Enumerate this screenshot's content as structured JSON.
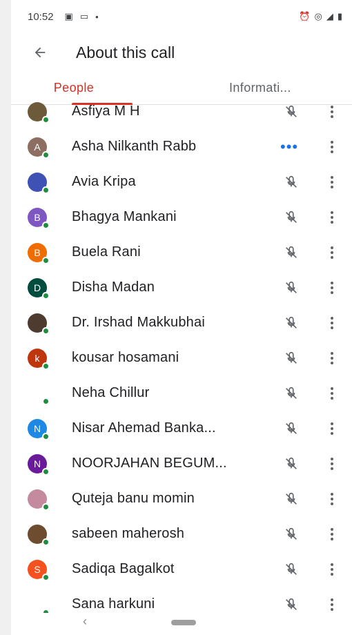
{
  "status_bar": {
    "time": "10:52",
    "left_icons": [
      "gallery-icon",
      "video-icon",
      "dot-icon"
    ],
    "right_icons": [
      "alarm-icon",
      "hotspot-icon",
      "signal-icon",
      "battery-icon"
    ]
  },
  "app_bar": {
    "back_icon": "arrow-left-icon",
    "title": "About this call"
  },
  "tabs": [
    {
      "label": "People",
      "active": true
    },
    {
      "label": "Informati...",
      "active": false
    }
  ],
  "participants": [
    {
      "name": "Asfiya M H",
      "avatar_letter": "",
      "avatar_color": "#6d5a3b",
      "status": "muted"
    },
    {
      "name": "Asha Nilkanth Rabb",
      "avatar_letter": "A",
      "avatar_color": "#8d6e63",
      "status": "speaking"
    },
    {
      "name": "Avia Kripa",
      "avatar_letter": "",
      "avatar_color": "#3f51b5",
      "status": "muted"
    },
    {
      "name": "Bhagya Mankani",
      "avatar_letter": "B",
      "avatar_color": "#7e57c2",
      "status": "muted"
    },
    {
      "name": "Buela Rani",
      "avatar_letter": "B",
      "avatar_color": "#ef6c00",
      "status": "muted"
    },
    {
      "name": "Disha Madan",
      "avatar_letter": "D",
      "avatar_color": "#004d40",
      "status": "muted"
    },
    {
      "name": "Dr. Irshad Makkubhai",
      "avatar_letter": "",
      "avatar_color": "#4e3b30",
      "status": "muted"
    },
    {
      "name": "kousar hosamani",
      "avatar_letter": "k",
      "avatar_color": "#bf360c",
      "status": "muted"
    },
    {
      "name": "Neha Chillur",
      "avatar_letter": "",
      "avatar_color": "#ffffff",
      "status": "muted"
    },
    {
      "name": "Nisar Ahemad Banka...",
      "avatar_letter": "N",
      "avatar_color": "#1e88e5",
      "status": "muted"
    },
    {
      "name": "NOORJAHAN BEGUM...",
      "avatar_letter": "N",
      "avatar_color": "#6a1b9a",
      "status": "muted"
    },
    {
      "name": "Quteja banu momin",
      "avatar_letter": "",
      "avatar_color": "#c48b9f",
      "status": "muted"
    },
    {
      "name": "sabeen maherosh",
      "avatar_letter": "",
      "avatar_color": "#6d4c2f",
      "status": "muted"
    },
    {
      "name": "Sadiqa Bagalkot",
      "avatar_letter": "S",
      "avatar_color": "#f4511e",
      "status": "muted"
    },
    {
      "name": "Sana harkuni",
      "avatar_letter": "",
      "avatar_color": "#ffffff",
      "status": "muted"
    }
  ],
  "nav_bar": {
    "back_icon": "nav-back-chevron-icon",
    "home_icon": "home-pill-icon"
  },
  "colors": {
    "accent": "#d93025",
    "online": "#1e8e3e",
    "speaking": "#1a73e8"
  }
}
